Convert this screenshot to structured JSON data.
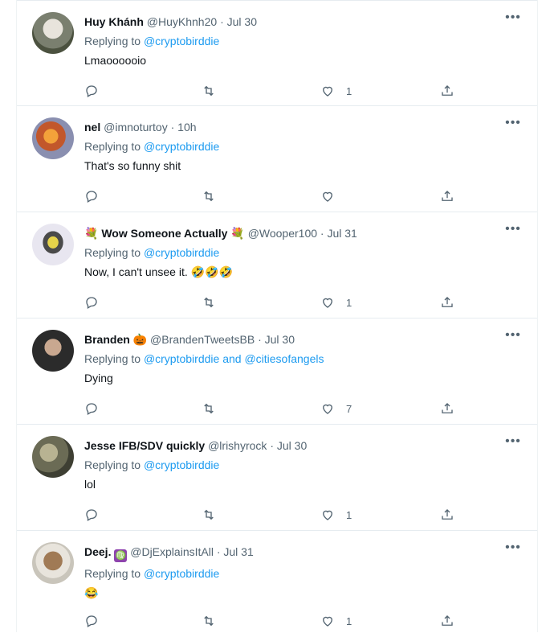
{
  "replies": [
    {
      "name": "Huy Khánh",
      "handle": "@HuyKhnh20",
      "time": "Jul 30",
      "replying_label": "Replying to",
      "replying_to": "@cryptobirddie",
      "text": "Lmaoooooio",
      "likes": "1",
      "avatar_color": "#6a6f60"
    },
    {
      "name": "nel",
      "handle": "@imnoturtoy",
      "time": "10h",
      "replying_label": "Replying to",
      "replying_to": "@cryptobirddie",
      "text": "That's so funny shit",
      "likes": "",
      "avatar_color": "#c2572b"
    },
    {
      "name": "Wow Someone Actually",
      "handle": "@Wooper100",
      "time": "Jul 31",
      "replying_label": "Replying to",
      "replying_to": "@cryptobirddie",
      "text": "Now, I can't unsee it. 🤣🤣🤣",
      "likes": "1",
      "avatar_color": "#d4c36b",
      "name_emoji": "💐"
    },
    {
      "name": "Branden",
      "handle": "@BrandenTweetsBB",
      "time": "Jul 30",
      "replying_label": "Replying to",
      "replying_to": "@cryptobirddie",
      "replying_and": "and",
      "replying_to_2": "@citiesofangels",
      "text": "Dying",
      "likes": "7",
      "avatar_color": "#2b2b2b",
      "name_emoji": "🎃"
    },
    {
      "name": "Jesse IFB/SDV quickly",
      "handle": "@lrishyrock",
      "time": "Jul 30",
      "replying_label": "Replying to",
      "replying_to": "@cryptobirddie",
      "text": "lol",
      "likes": "1",
      "avatar_color": "#6b6b55"
    },
    {
      "name": "Deej.",
      "handle": "@DjExplainsItAll",
      "time": "Jul 31",
      "replying_label": "Replying to",
      "replying_to": "@cryptobirddie",
      "text": "😂",
      "likes": "1",
      "avatar_color": "#8a6a48",
      "name_badge": "♍"
    }
  ],
  "separator": "·",
  "more": "•••",
  "icons": {
    "reply": "reply-icon",
    "retweet": "retweet-icon",
    "like": "heart-icon",
    "share": "share-icon",
    "more": "more-icon"
  },
  "colors": {
    "link": "#1d9bf0",
    "secondary": "#536471",
    "primary": "#0f1419",
    "divider": "#e6ecf0"
  }
}
